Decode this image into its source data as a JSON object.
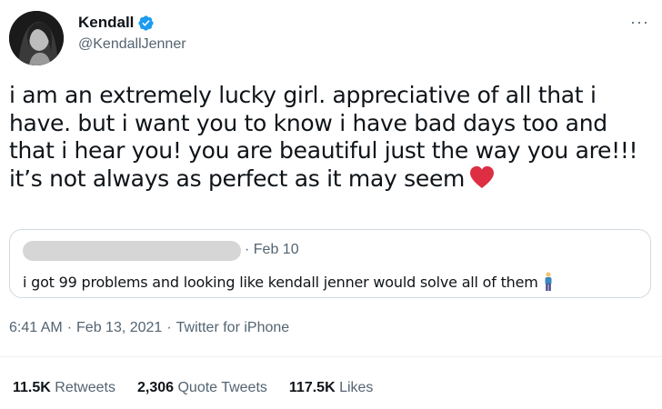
{
  "author": {
    "display_name": "Kendall",
    "handle": "@KendallJenner",
    "verified": true
  },
  "tweet": {
    "lines": [
      "i am an extremely lucky girl. appreciative of all that i",
      "have. but i want you to know i have bad days too and",
      "that i hear you! you are beautiful just the way you are!!!",
      "it’s not always as perfect as it may seem"
    ],
    "emoji": "red-heart",
    "accent_color": "#e0245e"
  },
  "quoted_tweet": {
    "date": "Feb 10",
    "separator": "·",
    "text": "i got 99 problems and looking like kendall jenner would solve all of them",
    "emoji": "man-standing"
  },
  "meta": {
    "time": "6:41 AM",
    "date": "Feb 13, 2021",
    "source": "Twitter for iPhone",
    "separator": "·"
  },
  "stats": {
    "retweets": {
      "count": "11.5K",
      "label": "Retweets"
    },
    "quotes": {
      "count": "2,306",
      "label": "Quote Tweets"
    },
    "likes": {
      "count": "117.5K",
      "label": "Likes"
    }
  },
  "more_icon": "more-horizontal-icon"
}
